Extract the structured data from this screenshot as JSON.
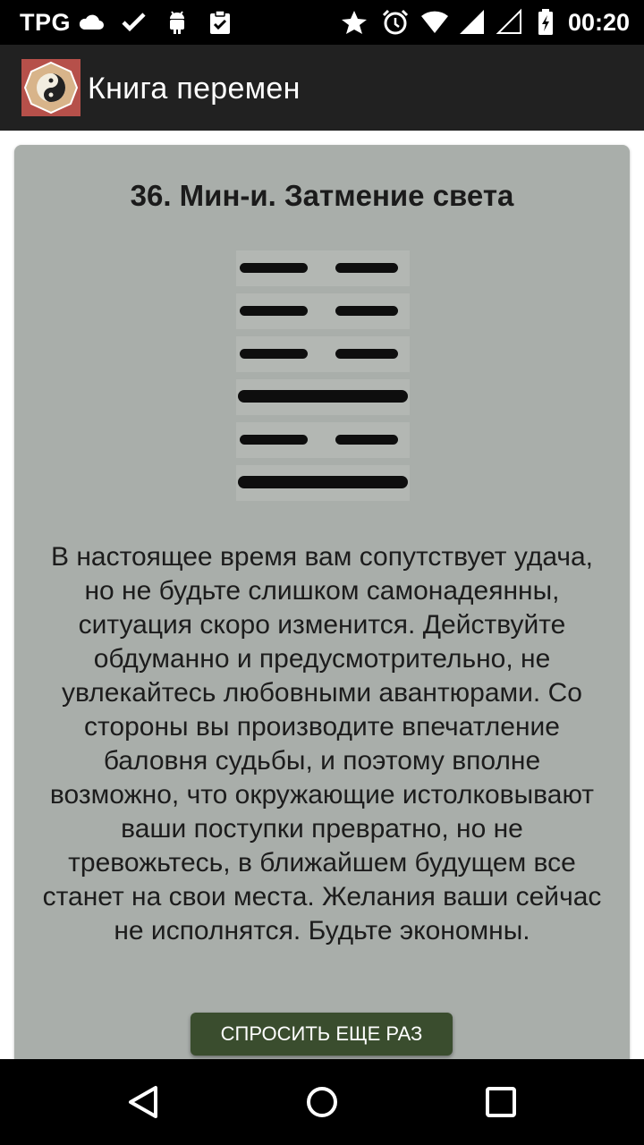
{
  "status_bar": {
    "carrier": "TPG",
    "time": "00:20",
    "icons": [
      "cloud-icon",
      "check-icon",
      "android-icon",
      "clipboard-check-icon",
      "star-icon",
      "alarm-icon",
      "wifi-icon",
      "signal-icon",
      "signal-empty-icon",
      "battery-charging-icon"
    ]
  },
  "app_bar": {
    "title": "Книга перемен",
    "logo": "yin-yang-logo"
  },
  "hexagram": {
    "title": "36. Мин-и. Затмение света",
    "lines_top_to_bottom": [
      "broken",
      "broken",
      "broken",
      "solid",
      "broken",
      "solid"
    ]
  },
  "prediction": {
    "lines": [
      "В настоящее время вам сопутствует удача,",
      "но не будьте слишком самонадеянны,",
      "ситуация скоро изменится. Действуйте",
      "обдуманно и предусмотрительно, не",
      "увлекайтесь любовными авантюрами. Со",
      "стороны вы производите впечатление",
      "баловня судьбы, и поэтому вполне",
      "возможно, что окружающие истолковывают",
      "ваши поступки превратно, но не",
      "тревожьтесь, в ближайшем будущем все",
      "станет на свои места. Желания ваши сейчас",
      "не исполнятся. Будьте экономны."
    ]
  },
  "actions": {
    "ask_again_label": "СПРОСИТЬ ЕЩЕ РАЗ"
  },
  "nav_bar": {
    "buttons": [
      "back-icon",
      "home-icon",
      "recents-icon"
    ]
  },
  "colors": {
    "card_background": "#a9aeaa",
    "button_background": "#3a4d2e",
    "app_bar_background": "#212121"
  }
}
